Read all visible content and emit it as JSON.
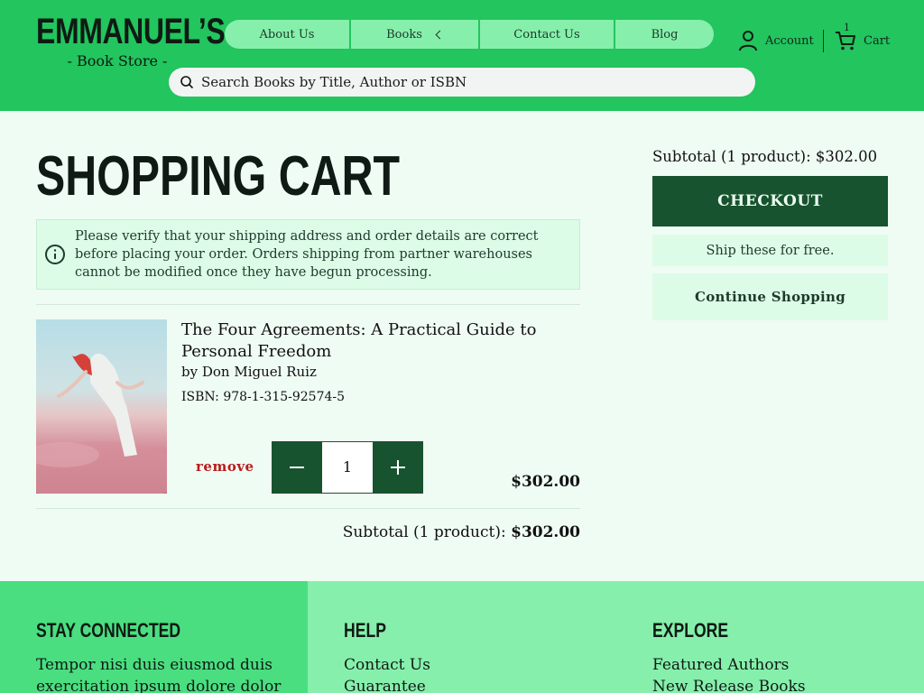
{
  "header": {
    "logo_main": "EMMANUEL’S",
    "logo_sub": "- Book Store -",
    "nav": [
      {
        "label": "About Us"
      },
      {
        "label": "Books"
      },
      {
        "label": "Contact Us"
      },
      {
        "label": "Blog"
      }
    ],
    "account_label": "Account",
    "cart_label": "Cart",
    "cart_count": "1",
    "search_placeholder": "Search Books by Title, Author or ISBN"
  },
  "main": {
    "title": "SHOPPING CART",
    "notice": "Please verify that your shipping address and order details are correct before placing your order. Orders shipping from partner warehouses cannot be modified once they have begun processing.",
    "item": {
      "title": "The Four Agreements: A Practical Guide to Personal Freedom",
      "author": "by Don Miguel Ruiz",
      "isbn": "ISBN: 978-1-315-92574-5",
      "remove_label": "remove",
      "quantity": "1",
      "price": "$302.00"
    },
    "subtotal_label": "Subtotal (1 product):",
    "subtotal_value": "$302.00"
  },
  "sidebar": {
    "subtotal": "Subtotal (1 product): $302.00",
    "checkout_label": "CHECKOUT",
    "ship_free": "Ship these for free.",
    "continue_label": "Continue Shopping"
  },
  "footer": {
    "stay_connected": {
      "heading": "STAY CONNECTED",
      "text": "Tempor nisi duis eiusmod duis exercitation ipsum dolore dolor"
    },
    "help": {
      "heading": "HELP",
      "links": [
        "Contact Us",
        "Guarantee"
      ]
    },
    "explore": {
      "heading": "EXPLORE",
      "links": [
        "Featured Authors",
        "New Release Books"
      ]
    }
  },
  "colors": {
    "header_green": "#22c55e",
    "nav_green": "#86efac",
    "dark_green": "#17532e",
    "light_green": "#dcfce7",
    "remove_red": "#b91c1c"
  },
  "icons": [
    "info-icon",
    "search-icon",
    "user-icon",
    "cart-icon",
    "minus-icon",
    "plus-icon",
    "chevron-left-icon"
  ]
}
